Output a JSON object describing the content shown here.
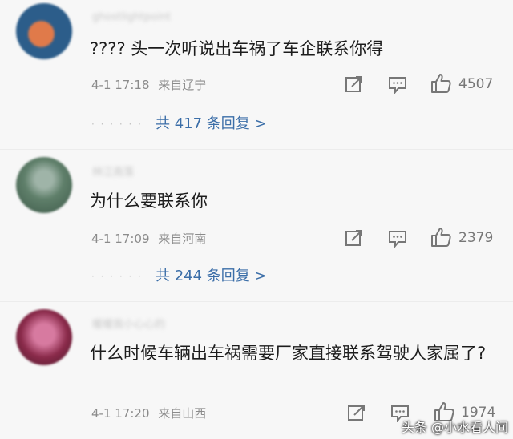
{
  "comments": [
    {
      "username": "ghostlightpoint",
      "text": "???? 头一次听说出车祸了车企联系你得",
      "date": "4-1 17:18",
      "location": "来自辽宁",
      "likes": "4507",
      "replies_label": "共 417 条回复 >",
      "avatar_colors": [
        "#2c5d8a",
        "#e07a4a"
      ]
    },
    {
      "username": "林江南落",
      "text": "为什么要联系你",
      "date": "4-1 17:09",
      "location": "来自河南",
      "likes": "2379",
      "replies_label": "共 244 条回复 >",
      "avatar_colors": [
        "#5f7f6a",
        "#9fb4a8"
      ]
    },
    {
      "username": "暖暖我小心心的",
      "text": "什么时候车辆出车祸需要厂家直接联系驾驶人家属了?",
      "date": "4-1 17:20",
      "location": "来自山西",
      "likes": "1974",
      "avatar_colors": [
        "#8a2a4a",
        "#d77aa0"
      ]
    }
  ],
  "icons": {
    "share": "share-icon",
    "comment": "comment-icon",
    "like": "thumbs-up-icon"
  },
  "watermark": "头条 @小水看人间",
  "colors": {
    "accent_link": "#3b6ea8",
    "meta_gray": "#8b8b8b",
    "background": "#f7f7f7"
  }
}
